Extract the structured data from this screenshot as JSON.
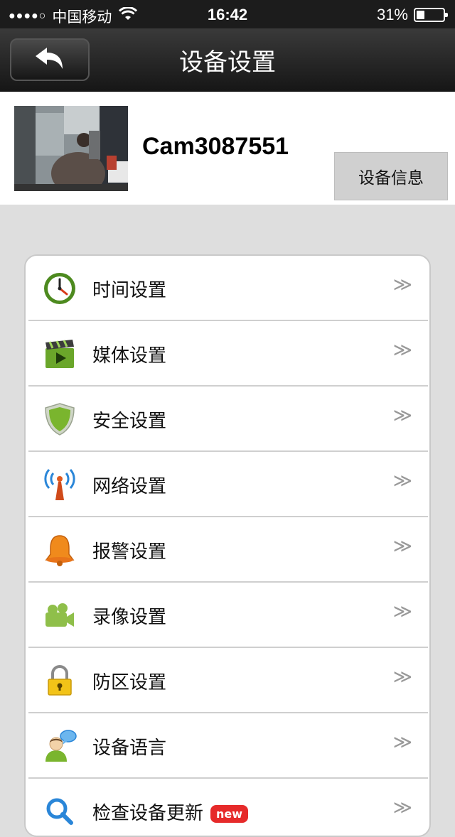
{
  "status_bar": {
    "signal": "●●●●○",
    "carrier": "中国移动",
    "time": "16:42",
    "battery_text": "31%",
    "battery_level": 0.31
  },
  "nav": {
    "title": "设备设置"
  },
  "device": {
    "name": "Cam3087551",
    "info_button": "设备信息"
  },
  "menu": {
    "items": [
      {
        "label": "时间设置",
        "icon": "clock-icon",
        "chevron": "≫"
      },
      {
        "label": "媒体设置",
        "icon": "clapperboard-icon",
        "chevron": "≫"
      },
      {
        "label": "安全设置",
        "icon": "shield-icon",
        "chevron": "≫"
      },
      {
        "label": "网络设置",
        "icon": "antenna-icon",
        "chevron": "≫"
      },
      {
        "label": "报警设置",
        "icon": "bell-icon",
        "chevron": "≫"
      },
      {
        "label": "录像设置",
        "icon": "video-camera-icon",
        "chevron": "≫"
      },
      {
        "label": "防区设置",
        "icon": "padlock-icon",
        "chevron": "≫"
      },
      {
        "label": "设备语言",
        "icon": "user-chat-icon",
        "chevron": "≫"
      },
      {
        "label": "检查设备更新",
        "icon": "update-icon",
        "chevron": "≫",
        "badge": "new"
      }
    ]
  },
  "colors": {
    "navbar": "#1c1c1c",
    "background": "#dedede",
    "badge": "#e62a2a"
  }
}
